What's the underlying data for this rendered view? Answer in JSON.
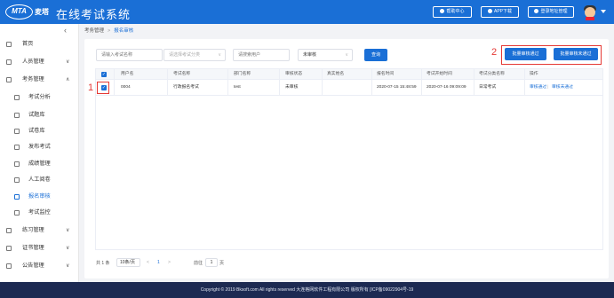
{
  "header": {
    "logo_badge": "MTA",
    "logo_text": "麦塔",
    "title": "在线考试系统",
    "buttons": [
      {
        "label": "帮助中心",
        "icon": "help-icon"
      },
      {
        "label": "APP下载",
        "icon": "phone-icon"
      },
      {
        "label": "登录地址管理",
        "icon": "link-icon"
      }
    ]
  },
  "sidebar": {
    "collapse_glyph": "‹",
    "items": [
      {
        "label": "首页",
        "icon": "home-icon"
      },
      {
        "label": "人员管理",
        "icon": "user-icon",
        "caret": "∨"
      },
      {
        "label": "考务管理",
        "icon": "exam-icon",
        "caret": "∧"
      },
      {
        "label": "考试分析",
        "icon": "analysis-icon"
      },
      {
        "label": "试题库",
        "icon": "question-bank-icon"
      },
      {
        "label": "试卷库",
        "icon": "paper-bank-icon"
      },
      {
        "label": "发布考试",
        "icon": "publish-icon"
      },
      {
        "label": "成绩管理",
        "icon": "score-icon"
      },
      {
        "label": "人工阅卷",
        "icon": "grading-icon"
      },
      {
        "label": "报名审核",
        "icon": "audit-icon"
      },
      {
        "label": "考试监控",
        "icon": "monitor-icon"
      },
      {
        "label": "练习管理",
        "icon": "practice-icon",
        "caret": "∨"
      },
      {
        "label": "证书管理",
        "icon": "certificate-icon",
        "caret": "∨"
      },
      {
        "label": "公告管理",
        "icon": "notice-icon",
        "caret": "∨"
      }
    ]
  },
  "breadcrumb": {
    "parent": "考务管理",
    "separator": ">",
    "current": "报名审核"
  },
  "filters": {
    "name_placeholder": "请输入考试名称",
    "exam_select_placeholder": "请选择考试分类",
    "user_placeholder": "请搜索用户",
    "status_value": "未审核",
    "query_label": "查询"
  },
  "actions": {
    "batch_pass": "批量审核通过",
    "batch_reject": "批量审核未通过"
  },
  "annotations": {
    "mark1": "1",
    "mark2": "2"
  },
  "table": {
    "columns": [
      "用户名",
      "考试名称",
      "部门名称",
      "审核状态",
      "真实姓名",
      "报名时间",
      "考试开始时间",
      "考试分类名称",
      "操作"
    ],
    "rows": [
      {
        "username": "0004",
        "exam_name": "行政报名考试",
        "department": "test",
        "status": "未审核",
        "real_name": "",
        "signup_time": "2020-07-15 15:48:59",
        "start_time": "2020-07-16 09:09:09",
        "category": "日常考试",
        "op_pass": "审核通过",
        "op_sep": "|",
        "op_reject": "审核未通过"
      }
    ]
  },
  "pagination": {
    "total": "共 1 条",
    "page_size": "10条/页",
    "prev": "<",
    "current": "1",
    "next": ">",
    "goto_label": "前往",
    "goto_value": "1",
    "page_suffix": "页"
  },
  "footer": {
    "text": "Copyright © 2019 Bksoft.com All rights reserved 大连格网软件工程有限公司 版权所有 [ICP备09022904号-19"
  },
  "colors": {
    "primary": "#1a6fd6",
    "footer": "#1d2a52",
    "highlight": "#e53935"
  }
}
